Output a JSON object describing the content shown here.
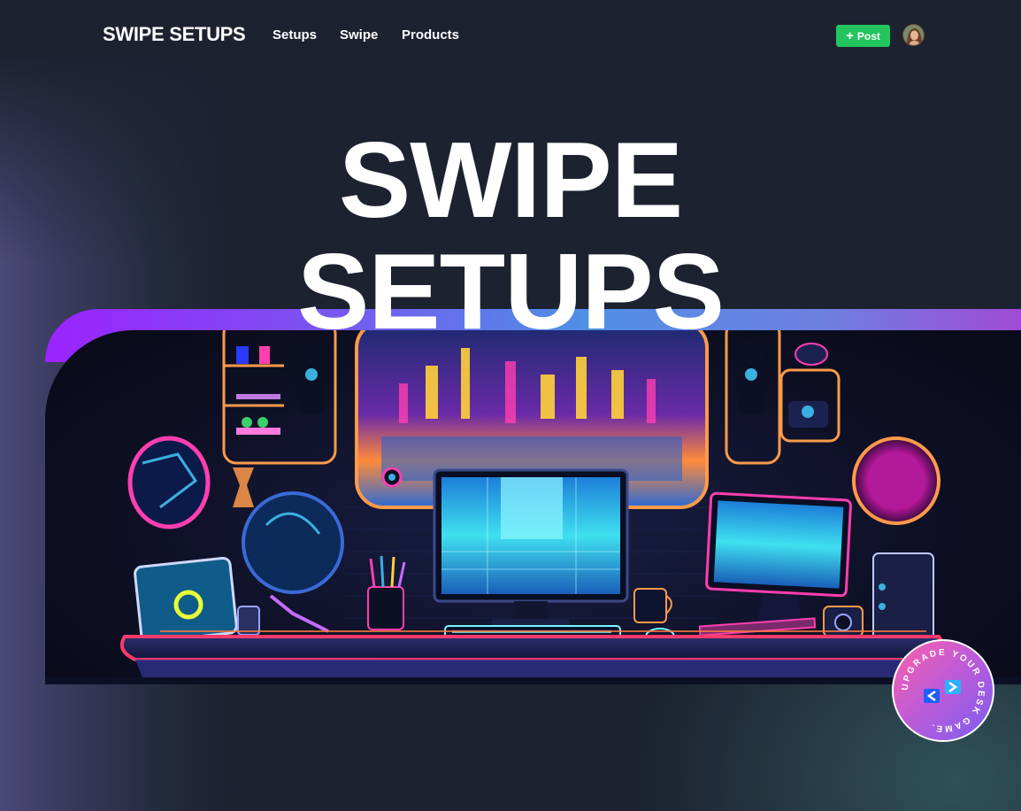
{
  "nav": {
    "brand": "SWIPE SETUPS",
    "links": [
      "Setups",
      "Swipe",
      "Products"
    ],
    "post_label": "Post",
    "post_icon": "plus-icon",
    "avatar": "user-avatar"
  },
  "hero": {
    "title_line1": "SWIPE",
    "title_line2": "SETUPS"
  },
  "banner": {
    "image": "neon-desk-setup-illustration"
  },
  "badge": {
    "ring_text": "UPGRADE YOUR DESK GAME.",
    "icon": "code-brackets-icon"
  },
  "colors": {
    "background": "#1c2230",
    "post_button": "#22c55e",
    "banner_gradient_start": "#9b23ff",
    "banner_gradient_end": "#a04ad6"
  }
}
